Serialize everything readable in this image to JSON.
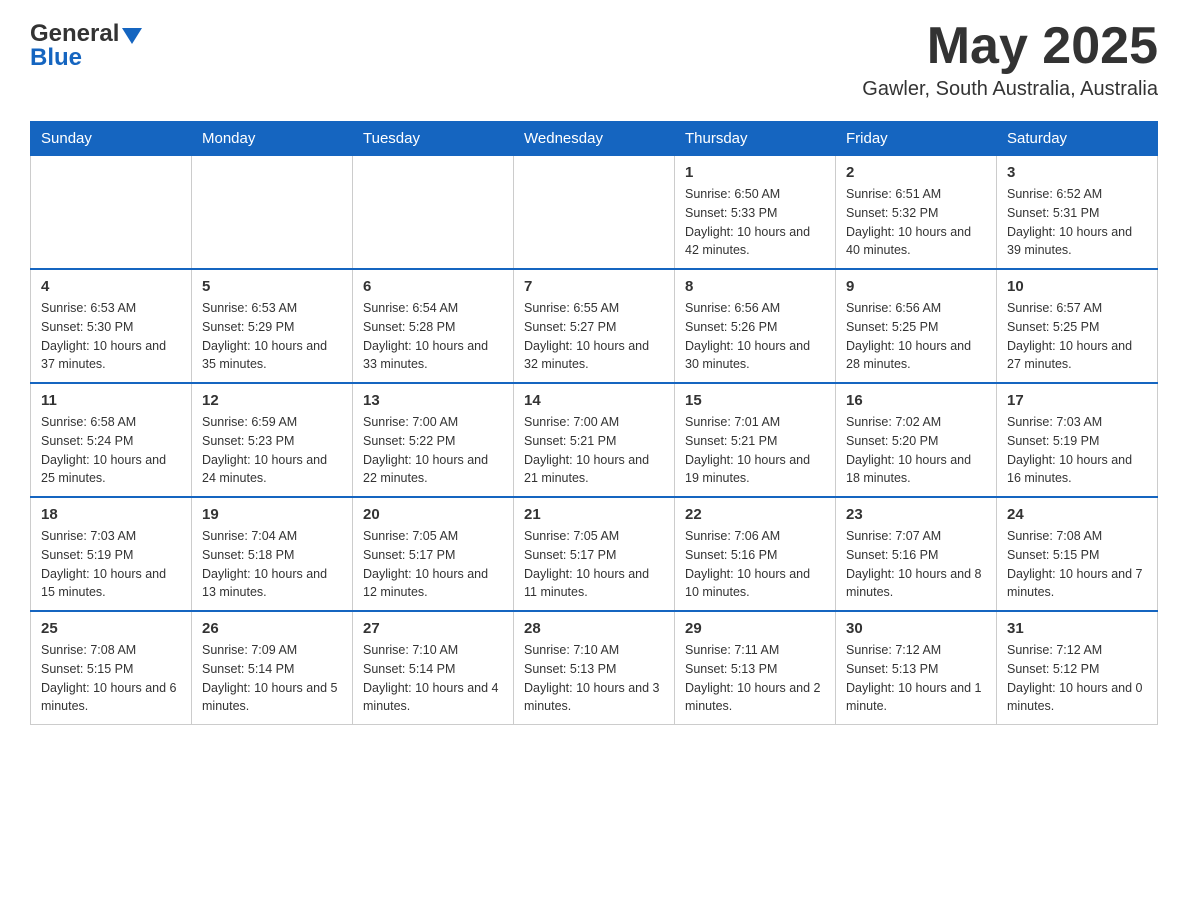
{
  "header": {
    "logo": {
      "general": "General",
      "blue": "Blue"
    },
    "title": "May 2025",
    "location": "Gawler, South Australia, Australia"
  },
  "weekdays": [
    "Sunday",
    "Monday",
    "Tuesday",
    "Wednesday",
    "Thursday",
    "Friday",
    "Saturday"
  ],
  "weeks": [
    {
      "days": [
        {
          "num": "",
          "sunrise": "",
          "sunset": "",
          "daylight": ""
        },
        {
          "num": "",
          "sunrise": "",
          "sunset": "",
          "daylight": ""
        },
        {
          "num": "",
          "sunrise": "",
          "sunset": "",
          "daylight": ""
        },
        {
          "num": "",
          "sunrise": "",
          "sunset": "",
          "daylight": ""
        },
        {
          "num": "1",
          "sunrise": "Sunrise: 6:50 AM",
          "sunset": "Sunset: 5:33 PM",
          "daylight": "Daylight: 10 hours and 42 minutes."
        },
        {
          "num": "2",
          "sunrise": "Sunrise: 6:51 AM",
          "sunset": "Sunset: 5:32 PM",
          "daylight": "Daylight: 10 hours and 40 minutes."
        },
        {
          "num": "3",
          "sunrise": "Sunrise: 6:52 AM",
          "sunset": "Sunset: 5:31 PM",
          "daylight": "Daylight: 10 hours and 39 minutes."
        }
      ]
    },
    {
      "days": [
        {
          "num": "4",
          "sunrise": "Sunrise: 6:53 AM",
          "sunset": "Sunset: 5:30 PM",
          "daylight": "Daylight: 10 hours and 37 minutes."
        },
        {
          "num": "5",
          "sunrise": "Sunrise: 6:53 AM",
          "sunset": "Sunset: 5:29 PM",
          "daylight": "Daylight: 10 hours and 35 minutes."
        },
        {
          "num": "6",
          "sunrise": "Sunrise: 6:54 AM",
          "sunset": "Sunset: 5:28 PM",
          "daylight": "Daylight: 10 hours and 33 minutes."
        },
        {
          "num": "7",
          "sunrise": "Sunrise: 6:55 AM",
          "sunset": "Sunset: 5:27 PM",
          "daylight": "Daylight: 10 hours and 32 minutes."
        },
        {
          "num": "8",
          "sunrise": "Sunrise: 6:56 AM",
          "sunset": "Sunset: 5:26 PM",
          "daylight": "Daylight: 10 hours and 30 minutes."
        },
        {
          "num": "9",
          "sunrise": "Sunrise: 6:56 AM",
          "sunset": "Sunset: 5:25 PM",
          "daylight": "Daylight: 10 hours and 28 minutes."
        },
        {
          "num": "10",
          "sunrise": "Sunrise: 6:57 AM",
          "sunset": "Sunset: 5:25 PM",
          "daylight": "Daylight: 10 hours and 27 minutes."
        }
      ]
    },
    {
      "days": [
        {
          "num": "11",
          "sunrise": "Sunrise: 6:58 AM",
          "sunset": "Sunset: 5:24 PM",
          "daylight": "Daylight: 10 hours and 25 minutes."
        },
        {
          "num": "12",
          "sunrise": "Sunrise: 6:59 AM",
          "sunset": "Sunset: 5:23 PM",
          "daylight": "Daylight: 10 hours and 24 minutes."
        },
        {
          "num": "13",
          "sunrise": "Sunrise: 7:00 AM",
          "sunset": "Sunset: 5:22 PM",
          "daylight": "Daylight: 10 hours and 22 minutes."
        },
        {
          "num": "14",
          "sunrise": "Sunrise: 7:00 AM",
          "sunset": "Sunset: 5:21 PM",
          "daylight": "Daylight: 10 hours and 21 minutes."
        },
        {
          "num": "15",
          "sunrise": "Sunrise: 7:01 AM",
          "sunset": "Sunset: 5:21 PM",
          "daylight": "Daylight: 10 hours and 19 minutes."
        },
        {
          "num": "16",
          "sunrise": "Sunrise: 7:02 AM",
          "sunset": "Sunset: 5:20 PM",
          "daylight": "Daylight: 10 hours and 18 minutes."
        },
        {
          "num": "17",
          "sunrise": "Sunrise: 7:03 AM",
          "sunset": "Sunset: 5:19 PM",
          "daylight": "Daylight: 10 hours and 16 minutes."
        }
      ]
    },
    {
      "days": [
        {
          "num": "18",
          "sunrise": "Sunrise: 7:03 AM",
          "sunset": "Sunset: 5:19 PM",
          "daylight": "Daylight: 10 hours and 15 minutes."
        },
        {
          "num": "19",
          "sunrise": "Sunrise: 7:04 AM",
          "sunset": "Sunset: 5:18 PM",
          "daylight": "Daylight: 10 hours and 13 minutes."
        },
        {
          "num": "20",
          "sunrise": "Sunrise: 7:05 AM",
          "sunset": "Sunset: 5:17 PM",
          "daylight": "Daylight: 10 hours and 12 minutes."
        },
        {
          "num": "21",
          "sunrise": "Sunrise: 7:05 AM",
          "sunset": "Sunset: 5:17 PM",
          "daylight": "Daylight: 10 hours and 11 minutes."
        },
        {
          "num": "22",
          "sunrise": "Sunrise: 7:06 AM",
          "sunset": "Sunset: 5:16 PM",
          "daylight": "Daylight: 10 hours and 10 minutes."
        },
        {
          "num": "23",
          "sunrise": "Sunrise: 7:07 AM",
          "sunset": "Sunset: 5:16 PM",
          "daylight": "Daylight: 10 hours and 8 minutes."
        },
        {
          "num": "24",
          "sunrise": "Sunrise: 7:08 AM",
          "sunset": "Sunset: 5:15 PM",
          "daylight": "Daylight: 10 hours and 7 minutes."
        }
      ]
    },
    {
      "days": [
        {
          "num": "25",
          "sunrise": "Sunrise: 7:08 AM",
          "sunset": "Sunset: 5:15 PM",
          "daylight": "Daylight: 10 hours and 6 minutes."
        },
        {
          "num": "26",
          "sunrise": "Sunrise: 7:09 AM",
          "sunset": "Sunset: 5:14 PM",
          "daylight": "Daylight: 10 hours and 5 minutes."
        },
        {
          "num": "27",
          "sunrise": "Sunrise: 7:10 AM",
          "sunset": "Sunset: 5:14 PM",
          "daylight": "Daylight: 10 hours and 4 minutes."
        },
        {
          "num": "28",
          "sunrise": "Sunrise: 7:10 AM",
          "sunset": "Sunset: 5:13 PM",
          "daylight": "Daylight: 10 hours and 3 minutes."
        },
        {
          "num": "29",
          "sunrise": "Sunrise: 7:11 AM",
          "sunset": "Sunset: 5:13 PM",
          "daylight": "Daylight: 10 hours and 2 minutes."
        },
        {
          "num": "30",
          "sunrise": "Sunrise: 7:12 AM",
          "sunset": "Sunset: 5:13 PM",
          "daylight": "Daylight: 10 hours and 1 minute."
        },
        {
          "num": "31",
          "sunrise": "Sunrise: 7:12 AM",
          "sunset": "Sunset: 5:12 PM",
          "daylight": "Daylight: 10 hours and 0 minutes."
        }
      ]
    }
  ]
}
